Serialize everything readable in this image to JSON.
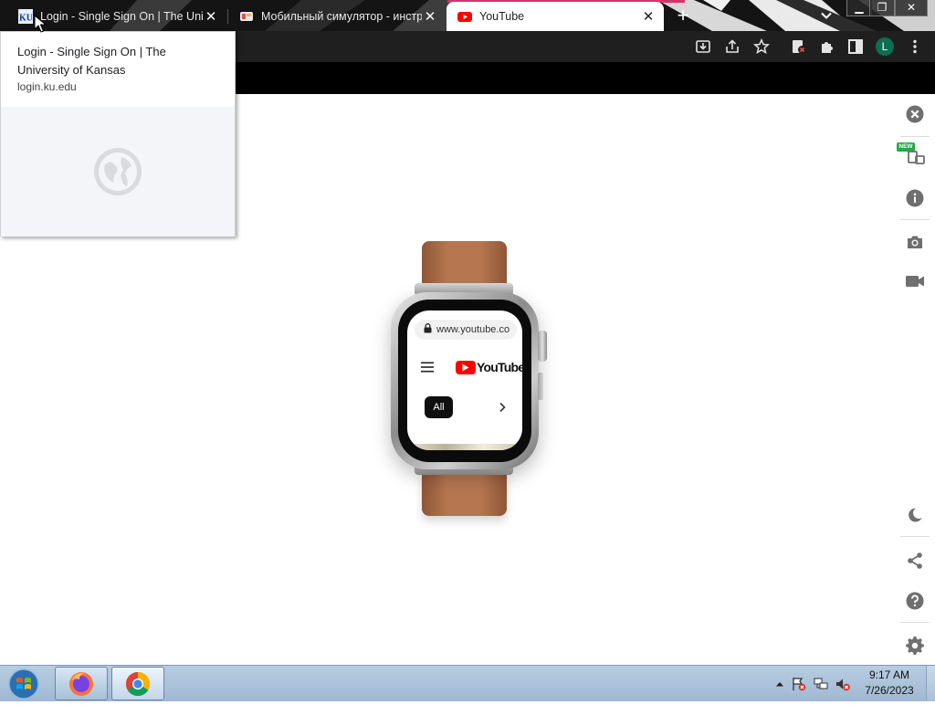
{
  "browser": {
    "tabs": [
      {
        "title": "Login - Single Sign On | The Univ",
        "favicon": "ku-icon",
        "active": false
      },
      {
        "title": "Мобильный симулятор - инстру",
        "favicon": "simulator-icon",
        "active": false
      },
      {
        "title": "YouTube",
        "favicon": "youtube-icon",
        "active": true
      }
    ],
    "new_tab_label": "+",
    "profile_initial": "L",
    "window_controls": [
      "minimize",
      "restore",
      "close"
    ]
  },
  "hover_card": {
    "title": "Login - Single Sign On | The University of Kansas",
    "url": "login.ku.edu"
  },
  "simulator": {
    "device": "apple-watch",
    "url": "www.youtube.co",
    "brand": "YouTube",
    "chip_all": "All",
    "rail_new_badge": "NEW",
    "rail_tools": [
      "close-icon",
      "device-switch-icon",
      "info-icon",
      "camera-icon",
      "video-icon",
      "moon-icon",
      "share-icon",
      "help-icon",
      "gear-icon"
    ]
  },
  "taskbar": {
    "apps": [
      "firefox",
      "chrome"
    ],
    "time": "9:17 AM",
    "date": "7/26/2023"
  },
  "colors": {
    "accent_red": "#ff0000",
    "tab_strip": "#141414",
    "toolbar": "#1f1f1f",
    "avatar": "#0f6e52",
    "new_badge": "#29a845"
  }
}
